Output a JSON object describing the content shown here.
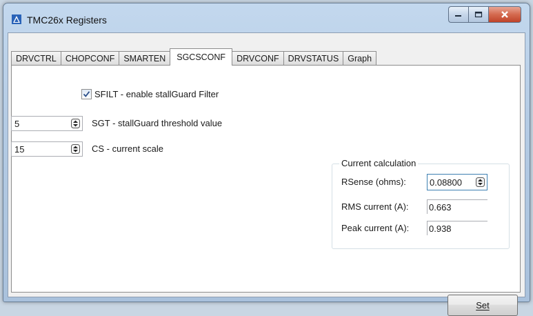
{
  "window": {
    "title": "TMC26x Registers",
    "controls": [
      "minimize",
      "maximize",
      "close"
    ]
  },
  "tabs": [
    {
      "label": "DRVCTRL",
      "active": false
    },
    {
      "label": "CHOPCONF",
      "active": false
    },
    {
      "label": "SMARTEN",
      "active": false
    },
    {
      "label": "SGCSCONF",
      "active": true
    },
    {
      "label": "DRVCONF",
      "active": false
    },
    {
      "label": "DRVSTATUS",
      "active": false
    },
    {
      "label": "Graph",
      "active": false
    }
  ],
  "sgcsconf": {
    "sfilt": {
      "label": "SFILT - enable stallGuard Filter",
      "checked": true
    },
    "sgt": {
      "value": "5",
      "label": "SGT - stallGuard threshold value"
    },
    "cs": {
      "value": "15",
      "label": "CS - current scale"
    }
  },
  "current_calc": {
    "title": "Current calculation",
    "rsense": {
      "label": "RSense (ohms):",
      "value": "0.08800"
    },
    "rms": {
      "label": "RMS current (A):",
      "value": "0.663"
    },
    "peak": {
      "label": "Peak current (A):",
      "value": "0.938"
    }
  },
  "set_button": {
    "label": "Set"
  },
  "colors": {
    "accent_focus": "#3c7fb1",
    "close_button": "#c9482e"
  }
}
